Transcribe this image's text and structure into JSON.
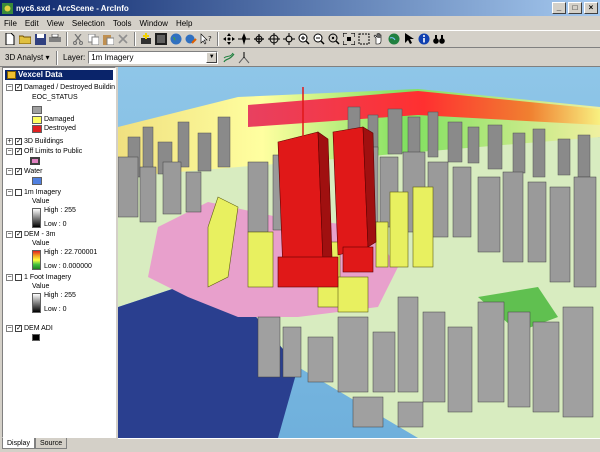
{
  "window": {
    "title": "nyc6.sxd - ArcScene - ArcInfo",
    "minimize": "_",
    "maximize": "□",
    "close": "×"
  },
  "menu": [
    "File",
    "Edit",
    "View",
    "Selection",
    "Tools",
    "Window",
    "Help"
  ],
  "toolbar2": {
    "analyst_label": "3D Analyst ▾",
    "layer_label": "Layer:",
    "layer_value": "1m Imagery"
  },
  "toc": {
    "title": "Vexcel Data",
    "layers": [
      {
        "name": "Damaged / Destroyed Buildin",
        "field": "EOC_STATUS",
        "classes": [
          {
            "label": "",
            "color": "#a0a0a0"
          },
          {
            "label": "Damaged",
            "color": "#ffff60"
          },
          {
            "label": "Destroyed",
            "color": "#e02020"
          }
        ]
      },
      {
        "name": "3D Buildings"
      },
      {
        "name": "Off Limits to Public",
        "color": "#e080c0"
      },
      {
        "name": "Water",
        "color": "#5080e0"
      },
      {
        "name": "1m Imagery",
        "value_label": "Value",
        "high": "High : 255",
        "low": "Low : 0"
      },
      {
        "name": "DEM - 3m",
        "value_label": "Value",
        "high": "High : 22.700001",
        "low": "Low : 0.000000"
      },
      {
        "name": "1 Foot Imagery",
        "value_label": "Value",
        "high": "High : 255",
        "low": "Low : 0"
      },
      {
        "name": "DEM ADI"
      }
    ]
  },
  "tabs": [
    "Display",
    "Source"
  ],
  "colors": {
    "title_start": "#0a246a",
    "title_end": "#a6caf0",
    "chrome": "#d4d0c8",
    "water": "#2a3f8f",
    "offlimits": "#e8a0cc",
    "destroyed": "#e01818",
    "damaged": "#e8f060",
    "building": "#9a9a9a"
  }
}
